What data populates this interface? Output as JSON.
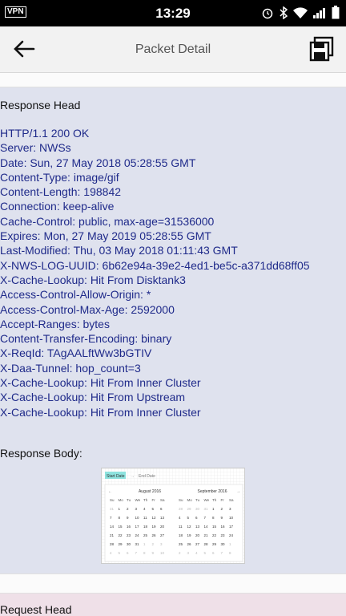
{
  "status": {
    "vpn": "VPN",
    "time": "13:29"
  },
  "appbar": {
    "title": "Packet Detail"
  },
  "response": {
    "head_title": "Response Head",
    "headers": [
      "HTTP/1.1 200 OK",
      "Server: NWSs",
      "Date: Sun, 27 May 2018 05:28:55 GMT",
      "Content-Type: image/gif",
      "Content-Length: 198842",
      "Connection: keep-alive",
      "Cache-Control: public, max-age=31536000",
      "Expires: Mon, 27 May 2019 05:28:55 GMT",
      "Last-Modified: Thu, 03 May 2018 01:11:43 GMT",
      "X-NWS-LOG-UUID: 6b62e94a-39e2-4ed1-be5c-a371dd68ff05",
      "X-Cache-Lookup: Hit From Disktank3",
      "Access-Control-Allow-Origin: *",
      "Access-Control-Max-Age: 2592000",
      "Accept-Ranges: bytes",
      "Content-Transfer-Encoding: binary",
      "X-ReqId: TAgAALftWw3bGTIV",
      "X-Daa-Tunnel: hop_count=3",
      "X-Cache-Lookup: Hit From Inner Cluster",
      "X-Cache-Lookup: Hit From Upstream",
      "X-Cache-Lookup: Hit From Inner Cluster"
    ],
    "body_title": "Response Body:",
    "preview": {
      "start_label": "Start Date",
      "end_label": "End Date",
      "month_left": "August 2016",
      "month_right": "September 2016",
      "weekdays": [
        "Su",
        "Mo",
        "Tu",
        "We",
        "Th",
        "Fr",
        "Sa"
      ]
    }
  },
  "request": {
    "head_title": "Request Head"
  }
}
